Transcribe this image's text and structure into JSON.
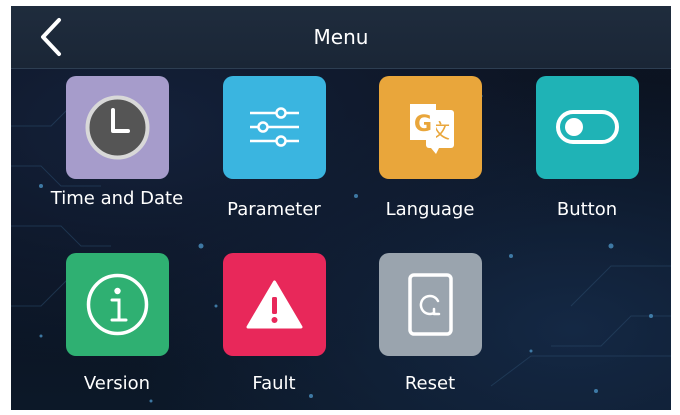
{
  "header": {
    "title": "Menu",
    "back_icon": "chevron-left-icon"
  },
  "menu": {
    "items": [
      {
        "label": "Time and Date",
        "icon": "clock-icon",
        "color": "#a69ccb"
      },
      {
        "label": "Parameter",
        "icon": "sliders-icon",
        "color": "#3ab5e0"
      },
      {
        "label": "Language",
        "icon": "translate-icon",
        "color": "#e9a63b"
      },
      {
        "label": "Button",
        "icon": "toggle-icon",
        "color": "#1fb3b6"
      },
      {
        "label": "Version",
        "icon": "info-icon",
        "color": "#2fb072"
      },
      {
        "label": "Fault",
        "icon": "warning-icon",
        "color": "#e8285a"
      },
      {
        "label": "Reset",
        "icon": "reset-icon",
        "color": "#9aa4ae"
      }
    ]
  }
}
